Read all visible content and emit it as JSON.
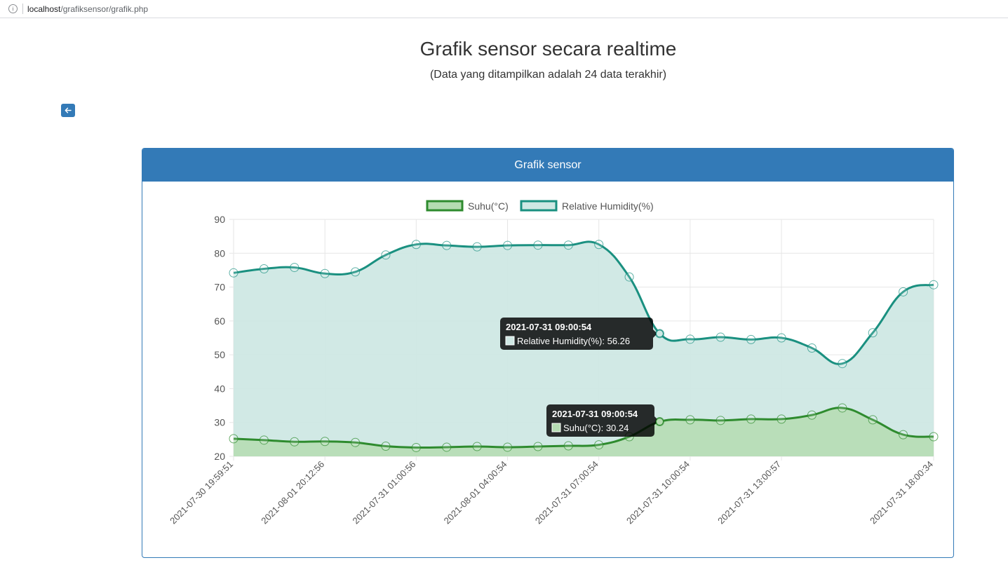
{
  "browser": {
    "url_host": "localhost",
    "url_path": "/grafiksensor/grafik.php"
  },
  "page": {
    "title": "Grafik sensor secara realtime",
    "subtitle": "(Data yang ditampilkan adalah 24 data terakhir)"
  },
  "panel": {
    "heading": "Grafik sensor"
  },
  "colors": {
    "primary": "#337ab7",
    "suhu_line": "#2e8b2e",
    "suhu_fill": "#b5dcb2",
    "humidity_line": "#1a9080",
    "humidity_fill": "#cfe8e4"
  },
  "icons": {
    "back": "arrow-left-icon"
  },
  "chart_data": {
    "type": "line",
    "x": [
      "2021-07-30 19:59:51",
      "",
      "",
      "2021-08-01 20:12:56",
      "",
      "",
      "2021-07-31 01:00:56",
      "",
      "",
      "2021-08-01 04:00:54",
      "",
      "",
      "2021-07-31 07:00:54",
      "",
      "",
      "2021-07-31 10:00:54",
      "",
      "",
      "2021-07-31 13:00:57",
      "",
      "",
      "",
      "",
      "2021-07-31 18:00:34"
    ],
    "series": [
      {
        "name": "Suhu(°C)",
        "values": [
          25.2,
          24.8,
          24.3,
          24.4,
          24.1,
          23.0,
          22.6,
          22.7,
          22.9,
          22.7,
          22.9,
          23.1,
          23.4,
          25.8,
          30.24,
          30.8,
          30.6,
          31.0,
          31.0,
          32.2,
          34.3,
          30.8,
          26.4,
          25.8
        ]
      },
      {
        "name": "Relative Humidity(%)",
        "values": [
          74.2,
          75.4,
          75.8,
          74.0,
          74.5,
          79.5,
          82.6,
          82.3,
          81.9,
          82.3,
          82.4,
          82.4,
          82.6,
          73.0,
          56.26,
          54.6,
          55.2,
          54.5,
          55.0,
          52.0,
          47.4,
          56.5,
          68.6,
          70.7
        ]
      }
    ],
    "ylim": [
      20,
      90
    ],
    "yticks": [
      20,
      30,
      40,
      50,
      60,
      70,
      80,
      90
    ],
    "grid": true,
    "legend": "top-center",
    "tooltips": [
      {
        "title": "2021-07-31 09:00:54",
        "label": "Relative Humidity(%): 56.26",
        "series": 1,
        "index": 14
      },
      {
        "title": "2021-07-31 09:00:54",
        "label": "Suhu(°C): 30.24",
        "series": 0,
        "index": 14
      }
    ]
  }
}
